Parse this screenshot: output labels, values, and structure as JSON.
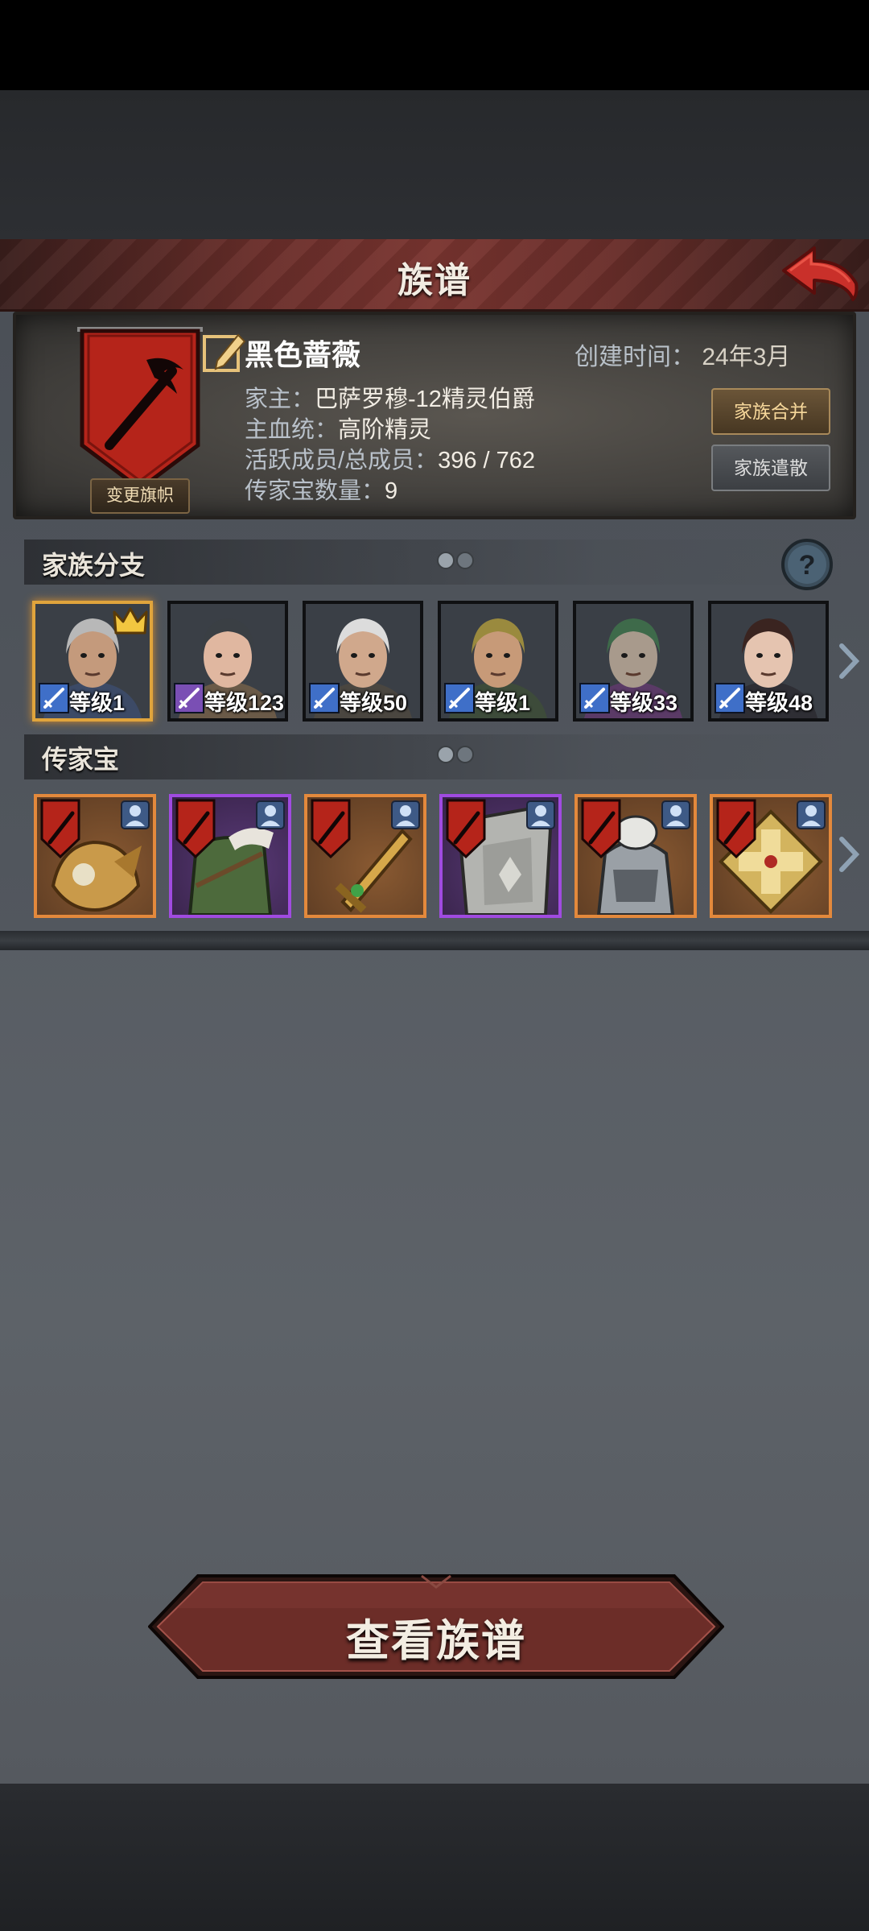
{
  "header": {
    "title": "族谱"
  },
  "family": {
    "name": "黑色蔷薇",
    "banner_button": "变更旗帜",
    "created_label": "创建时间：",
    "created_value": "24年3月",
    "head_label": "家主：",
    "head_value": "巴萨罗穆-12精灵伯爵",
    "bloodline_label": "主血统：",
    "bloodline_value": "高阶精灵",
    "members_label": "活跃成员/总成员：",
    "members_value": "396 / 762",
    "heirloom_count_label": "传家宝数量：",
    "heirloom_count_value": "9",
    "merge_button": "家族合并",
    "dismiss_button": "家族遣散"
  },
  "branches": {
    "title": "家族分支",
    "members": [
      {
        "level": "等级1",
        "class": "sword",
        "leader": true,
        "hair": "#b8b8b8",
        "skin": "#c49a7c",
        "cloth": "#3c4a66"
      },
      {
        "level": "等级123",
        "class": "staff",
        "leader": false,
        "hair": "#3a3f44",
        "skin": "#e0b7a0",
        "cloth": "#6a5a48"
      },
      {
        "level": "等级50",
        "class": "sword",
        "leader": false,
        "hair": "#dcdcdc",
        "skin": "#d0a88c",
        "cloth": "#4a4640"
      },
      {
        "level": "等级1",
        "class": "sword",
        "leader": false,
        "hair": "#9a8a3e",
        "skin": "#c79a78",
        "cloth": "#3d4b3a"
      },
      {
        "level": "等级33",
        "class": "sword",
        "leader": false,
        "hair": "#3e6a4a",
        "skin": "#a89a8c",
        "cloth": "#5a3a66"
      },
      {
        "level": "等级48",
        "class": "sword",
        "leader": false,
        "hair": "#3a2420",
        "skin": "#e5c4b0",
        "cloth": "#2e2e34"
      }
    ]
  },
  "heirlooms": {
    "title": "传家宝",
    "items": [
      {
        "name": "golden-dragon-helm",
        "rarity": "orange"
      },
      {
        "name": "green-fur-coat",
        "rarity": "purple"
      },
      {
        "name": "golden-dagger",
        "rarity": "orange"
      },
      {
        "name": "steel-shield",
        "rarity": "purple"
      },
      {
        "name": "silver-armor",
        "rarity": "orange"
      },
      {
        "name": "golden-cross-shield",
        "rarity": "orange"
      }
    ]
  },
  "actions": {
    "view_button": "查看族谱"
  },
  "colors": {
    "accent_red": "#8e2b22",
    "gold": "#e0a43c",
    "rarity_orange": "#e3893c",
    "rarity_purple": "#a04be0"
  },
  "icons": {
    "back": "red-back-arrow-icon",
    "help": "question-mark-icon",
    "edit": "pencil-edit-icon",
    "crown": "crown-icon",
    "person": "person-icon",
    "pager": "pager-dots-icon",
    "next": "chevron-right-icon"
  }
}
